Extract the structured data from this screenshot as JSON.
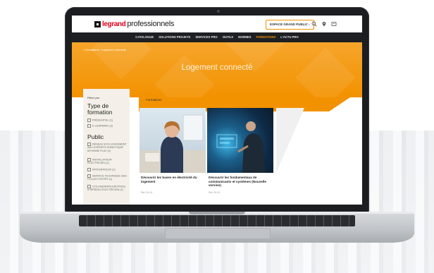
{
  "site": {
    "logo_brand": "legrand",
    "logo_sub": "professionnels",
    "espace_button": "ESPACE GRAND PUBLIC  ›",
    "icons": [
      "search-icon",
      "location-icon",
      "cart-icon"
    ]
  },
  "nav": {
    "items": [
      "CATALOGUE",
      "SOLUTIONS PROJETS",
      "SERVICES PRO",
      "OUTILS",
      "NORMES",
      "FORMATIONS",
      "L'ACTU PRO"
    ],
    "active": "FORMATIONS"
  },
  "hero": {
    "breadcrumb": "› Formations › Logement connecté",
    "title": "Logement connecté"
  },
  "filters": {
    "header": "Filtrer par",
    "type_title": "Type de formation",
    "type_options": [
      "PRÉSENTIEL (1)",
      "E-LEARNING (3)"
    ],
    "public_title": "Public",
    "public_options": [
      "RÉSEAU EXCLUSIVEMENT AUX EXPERTS DOMOTIQUE MYHOME PLAY (1)",
      "INSTALLATEUR ÉLECTRICIEN (1)",
      "INTÉGRATEUR (1)",
      "SERVICE TECHNIQUE DES COLLECTIVITÉS (1)",
      "COLLABORATEUR(TRICE) & RÉSEAU ÉLECTRICIEN (1)"
    ]
  },
  "listing": {
    "label": "Formations",
    "cards": [
      {
        "title": "Découvrir les bases en électricité du logement",
        "meta": "Réf. 09-10"
      },
      {
        "title": "Découvrir les fondamentaux de communicants et systèmes (Nouvelle version)",
        "meta": "Réf. 09-10"
      }
    ]
  },
  "colors": {
    "accent": "#f39200",
    "brand_red": "#e2001a",
    "nav_bg": "#1d1f23"
  }
}
